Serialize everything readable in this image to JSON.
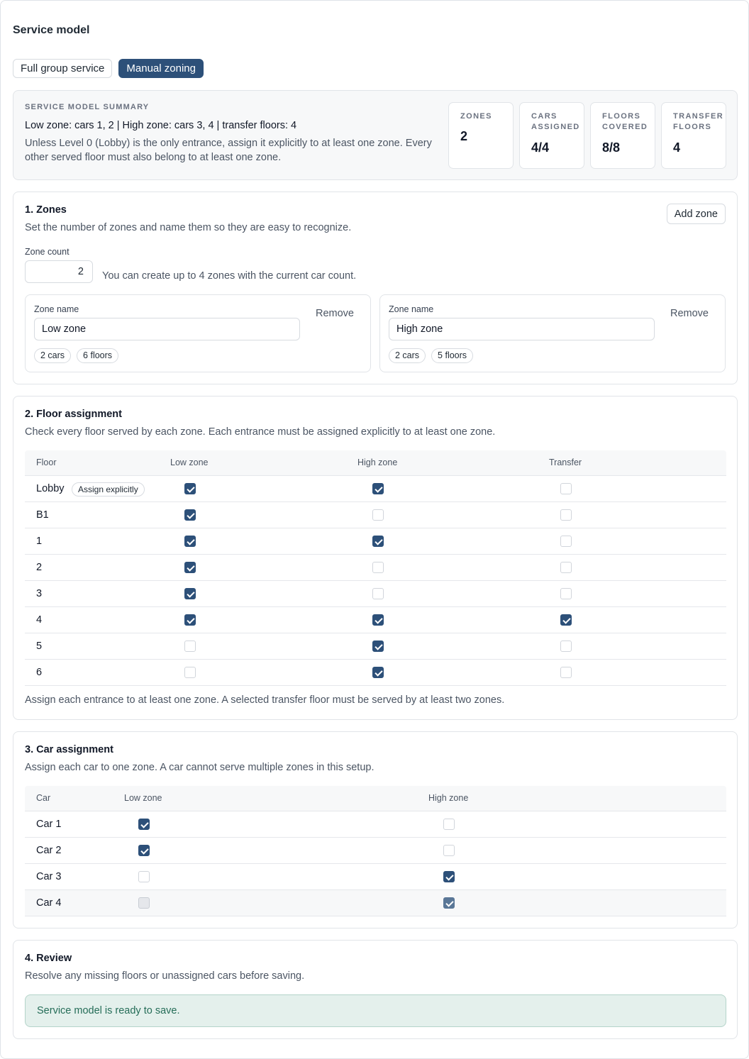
{
  "page": {
    "title": "Service model"
  },
  "modes": [
    {
      "label": "Full group service",
      "active": false
    },
    {
      "label": "Manual zoning",
      "active": true
    }
  ],
  "summary": {
    "kicker": "SERVICE MODEL SUMMARY",
    "line": "Low zone: cars 1, 2 | High zone: cars 3, 4 | transfer floors: 4",
    "note": "Unless Level 0 (Lobby) is the only entrance, assign it explicitly to at least one zone. Every other served floor must also belong to at least one zone.",
    "stats": [
      {
        "label": "ZONES",
        "value": "2"
      },
      {
        "label": "CARS ASSIGNED",
        "value": "4/4"
      },
      {
        "label": "FLOORS COVERED",
        "value": "8/8"
      },
      {
        "label": "TRANSFER FLOORS",
        "value": "4"
      }
    ]
  },
  "zones_section": {
    "title": "1. Zones",
    "description": "Set the number of zones and name them so they are easy to recognize.",
    "add_button": "Add zone",
    "count_label": "Zone count",
    "count_value": "2",
    "count_hint": "You can create up to 4 zones with the current car count.",
    "zones": [
      {
        "field_label": "Zone name",
        "name": "Low zone",
        "remove_label": "Remove",
        "cars": "2 cars",
        "floors": "6 floors"
      },
      {
        "field_label": "Zone name",
        "name": "High zone",
        "remove_label": "Remove",
        "cars": "2 cars",
        "floors": "5 floors"
      }
    ]
  },
  "floor_section": {
    "title": "2. Floor assignment",
    "description": "Check every floor served by each zone. Each entrance must be assigned explicitly to at least one zone.",
    "headers": [
      "Floor",
      "Low zone",
      "High zone",
      "Transfer"
    ],
    "assign_chip": "Assign explicitly",
    "rows": [
      {
        "floor": "Lobby",
        "low": true,
        "high": true,
        "transfer": false
      },
      {
        "floor": "B1",
        "low": true,
        "high": false,
        "transfer": false
      },
      {
        "floor": "1",
        "low": true,
        "high": true,
        "transfer": false
      },
      {
        "floor": "2",
        "low": true,
        "high": false,
        "transfer": false
      },
      {
        "floor": "3",
        "low": true,
        "high": false,
        "transfer": false
      },
      {
        "floor": "4",
        "low": true,
        "high": true,
        "transfer": true
      },
      {
        "floor": "5",
        "low": false,
        "high": true,
        "transfer": false
      },
      {
        "floor": "6",
        "low": false,
        "high": true,
        "transfer": false
      }
    ],
    "footnote": "Assign each entrance to at least one zone. A selected transfer floor must be served by at least two zones."
  },
  "car_section": {
    "title": "3. Car assignment",
    "description": "Assign each car to one zone. A car cannot serve multiple zones in this setup.",
    "headers": [
      "Car",
      "Low zone",
      "High zone"
    ],
    "rows": [
      {
        "car": "Car 1",
        "low": true,
        "high": false,
        "disabled": false
      },
      {
        "car": "Car 2",
        "low": true,
        "high": false,
        "disabled": false
      },
      {
        "car": "Car 3",
        "low": false,
        "high": true,
        "disabled": false
      },
      {
        "car": "Car 4",
        "low": false,
        "high": true,
        "disabled": true
      }
    ]
  },
  "review_section": {
    "title": "4. Review",
    "description": "Resolve any missing floors or unassigned cars before saving.",
    "status": "Service model is ready to save.",
    "status_color": "#256d58"
  },
  "colors": {
    "accent": "#2d5079",
    "success_bg": "#e4f0ec"
  }
}
